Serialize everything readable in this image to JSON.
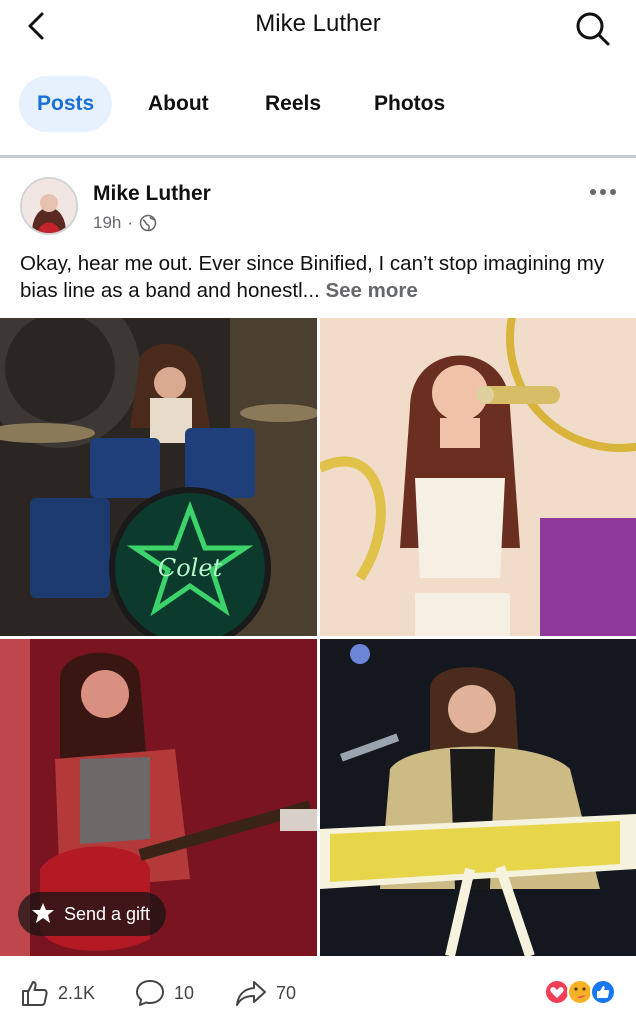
{
  "header": {
    "title": "Mike Luther",
    "back_icon": "chevron-left-icon",
    "search_icon": "search-icon"
  },
  "tabs": [
    {
      "label": "Posts",
      "active": true
    },
    {
      "label": "About",
      "active": false
    },
    {
      "label": "Reels",
      "active": false
    },
    {
      "label": "Photos",
      "active": false
    }
  ],
  "post": {
    "author": "Mike Luther",
    "time": "19h",
    "separator": "·",
    "privacy_icon": "globe-icon",
    "text": "Okay, hear me out. Ever since Binified, I can’t stop imagining my bias line as a band and honestl...",
    "see_more": "See more",
    "photos": [
      {
        "name": "photo-drummer",
        "description_icon": "drum-photo",
        "drum_logo": "Colet"
      },
      {
        "name": "photo-singer",
        "description_icon": "singer-photo"
      },
      {
        "name": "photo-guitarist",
        "description_icon": "guitar-photo"
      },
      {
        "name": "photo-keyboardist",
        "description_icon": "keyboard-photo"
      }
    ],
    "gift_label": "Send a gift",
    "likes": "2.1K",
    "comments": "10",
    "shares": "70"
  },
  "colors": {
    "accent": "#1b6fd8",
    "active_tab_bg": "#e7f1fd",
    "secondary_text": "#65676b"
  }
}
